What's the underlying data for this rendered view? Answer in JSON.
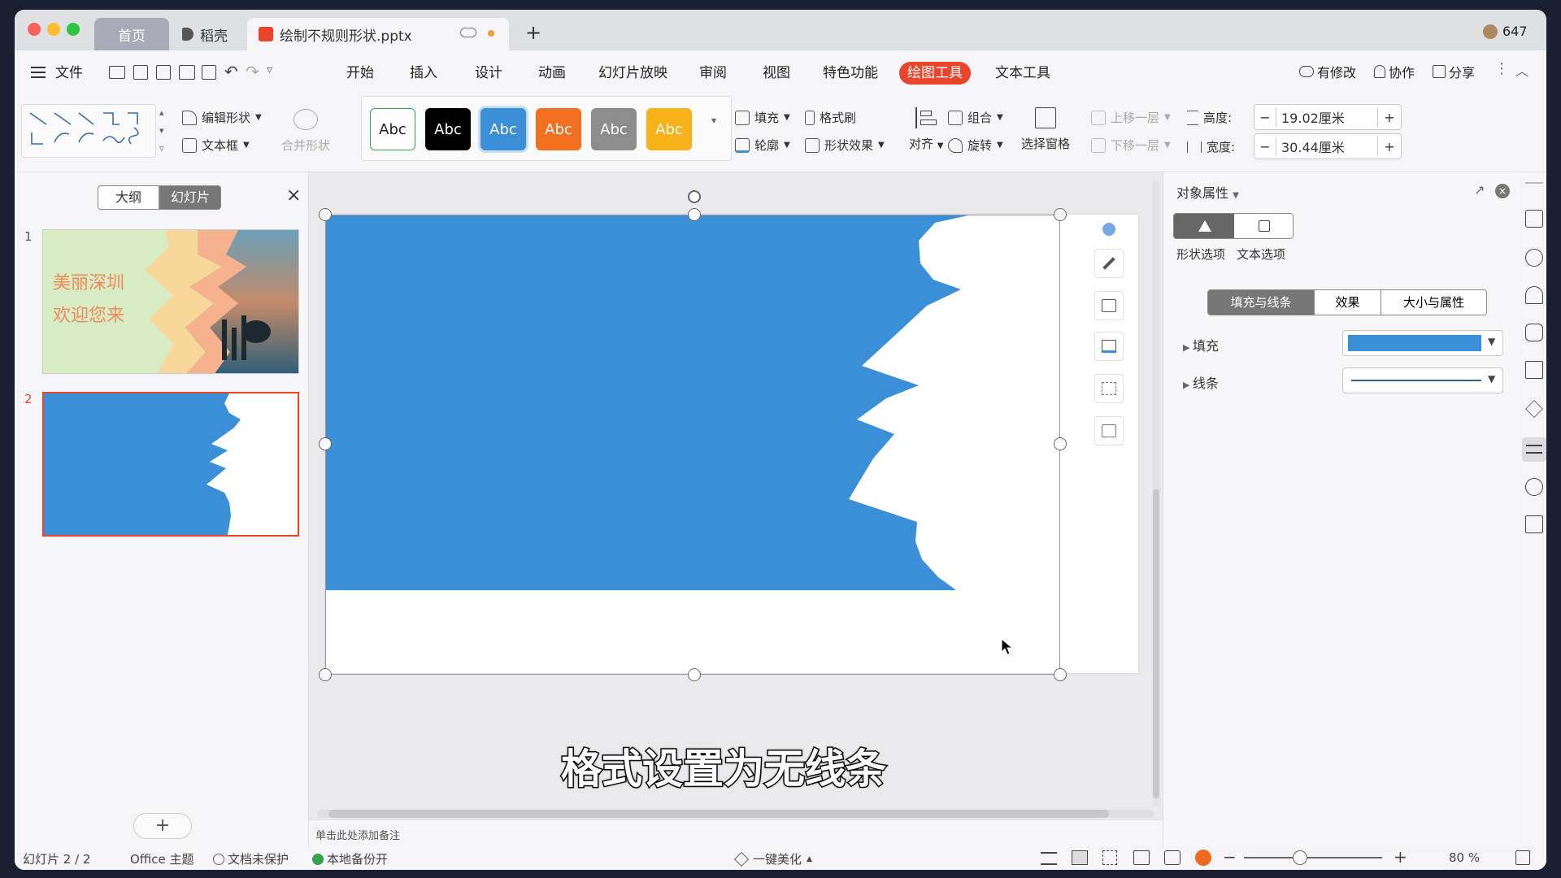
{
  "titlebar": {
    "tabs": [
      {
        "label": "首页"
      },
      {
        "label": "稻壳"
      },
      {
        "label": "绘制不规则形状.pptx"
      }
    ],
    "user_count": "647"
  },
  "menu": {
    "file": "文件",
    "tabs": [
      "开始",
      "插入",
      "设计",
      "动画",
      "幻灯片放映",
      "审阅",
      "视图",
      "特色功能",
      "绘图工具",
      "文本工具"
    ],
    "active_tab": "绘图工具",
    "right": {
      "modified": "有修改",
      "collab": "协作",
      "share": "分享"
    }
  },
  "ribbon": {
    "edit_shape": "编辑形状",
    "textbox": "文本框",
    "merge_shape": "合并形状",
    "style_label": "Abc",
    "fill": "填充",
    "format_painter": "格式刷",
    "outline": "轮廓",
    "shape_effect": "形状效果",
    "align": "对齐",
    "group": "组合",
    "rotate": "旋转",
    "selection_pane": "选择窗格",
    "bring_forward": "上移一层",
    "send_backward": "下移一层",
    "height_label": "高度:",
    "height_value": "19.02厘米",
    "width_label": "宽度:",
    "width_value": "30.44厘米",
    "minus": "−",
    "plus": "+"
  },
  "leftpane": {
    "tab_outline": "大纲",
    "tab_slides": "幻灯片",
    "close": "×",
    "slides": [
      {
        "num": "1",
        "title1": "美丽深圳",
        "title2": "欢迎您来"
      },
      {
        "num": "2"
      }
    ],
    "add": "+"
  },
  "canvas": {
    "notes_placeholder": "单击此处添加备注",
    "subtitle": "格式设置为无线条"
  },
  "rightpane": {
    "title": "对象属性",
    "tab_shape": "形状选项",
    "tab_text": "文本选项",
    "subtabs": [
      "填充与线条",
      "效果",
      "大小与属性"
    ],
    "fill_label": "填充",
    "line_label": "线条",
    "fill_color": "#3a8fd6"
  },
  "status": {
    "slide": "幻灯片 2 / 2",
    "theme": "Office 主题",
    "protect": "文档未保护",
    "backup": "本地备份开",
    "beautify": "一键美化",
    "zoom": "80 %"
  },
  "colors": {
    "shape_blue": "#3a8fd6",
    "accent_red": "#e8452c",
    "style_colors": [
      "#ffffff",
      "#000000",
      "#3a8fd6",
      "#f07020",
      "#8c8c8c",
      "#f7b21a"
    ]
  }
}
